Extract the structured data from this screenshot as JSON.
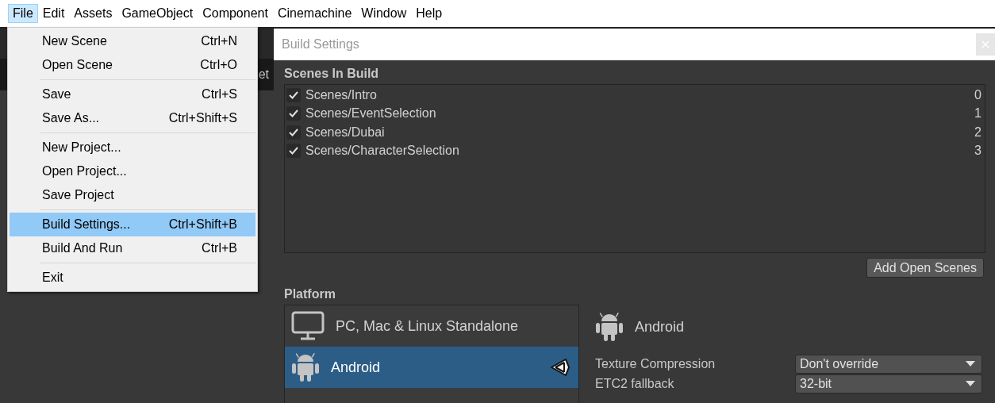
{
  "menu_bar": [
    {
      "label": "File",
      "selected": true
    },
    {
      "label": "Edit",
      "selected": false
    },
    {
      "label": "Assets",
      "selected": false
    },
    {
      "label": "GameObject",
      "selected": false
    },
    {
      "label": "Component",
      "selected": false
    },
    {
      "label": "Cinemachine",
      "selected": false
    },
    {
      "label": "Window",
      "selected": false
    },
    {
      "label": "Help",
      "selected": false
    }
  ],
  "background_tab": {
    "label": "et"
  },
  "file_menu": {
    "groups": [
      [
        {
          "label": "New Scene",
          "shortcut": "Ctrl+N",
          "selected": false
        },
        {
          "label": "Open Scene",
          "shortcut": "Ctrl+O",
          "selected": false
        }
      ],
      [
        {
          "label": "Save",
          "shortcut": "Ctrl+S",
          "selected": false
        },
        {
          "label": "Save As...",
          "shortcut": "Ctrl+Shift+S",
          "selected": false
        }
      ],
      [
        {
          "label": "New Project...",
          "selected": false
        },
        {
          "label": "Open Project...",
          "selected": false
        },
        {
          "label": "Save Project",
          "selected": false
        }
      ],
      [
        {
          "label": "Build Settings...",
          "shortcut": "Ctrl+Shift+B",
          "selected": true
        },
        {
          "label": "Build And Run",
          "shortcut": "Ctrl+B",
          "selected": false
        }
      ],
      [
        {
          "label": "Exit",
          "selected": false
        }
      ]
    ]
  },
  "build_settings": {
    "title": "Build Settings",
    "scenes_header": "Scenes In Build",
    "scenes": [
      {
        "name": "Scenes/Intro",
        "index": "0",
        "checked": true
      },
      {
        "name": "Scenes/EventSelection",
        "index": "1",
        "checked": true
      },
      {
        "name": "Scenes/Dubai",
        "index": "2",
        "checked": true
      },
      {
        "name": "Scenes/CharacterSelection",
        "index": "3",
        "checked": true
      }
    ],
    "add_open_scenes_button": "Add Open Scenes",
    "platform_header": "Platform",
    "platforms": [
      {
        "name": "PC, Mac & Linux Standalone",
        "kind": "desktop",
        "selected": false,
        "active": false
      },
      {
        "name": "Android",
        "kind": "android",
        "selected": true,
        "active": true
      }
    ],
    "detail": {
      "platform": "Android",
      "kind": "android",
      "settings": [
        {
          "label": "Texture Compression",
          "value": "Don't override"
        },
        {
          "label": "ETC2 fallback",
          "value": "32-bit"
        }
      ]
    }
  }
}
